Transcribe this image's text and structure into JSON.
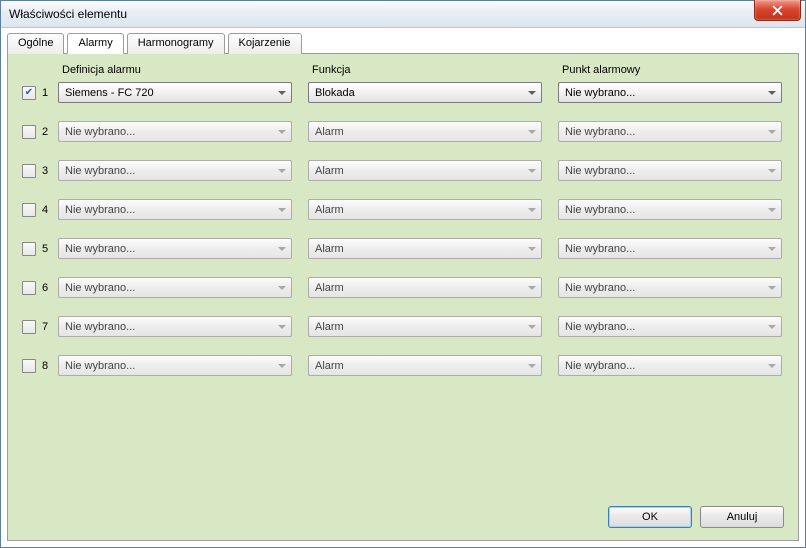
{
  "window": {
    "title": "Właściwości elementu"
  },
  "tabs": {
    "general": "Ogólne",
    "alarms": "Alarmy",
    "schedules": "Harmonogramy",
    "pairing": "Kojarzenie"
  },
  "headers": {
    "definition": "Definicja alarmu",
    "function": "Funkcja",
    "point": "Punkt alarmowy"
  },
  "rows": [
    {
      "n": "1",
      "checked": true,
      "enabled": true,
      "definition": "Siemens - FC 720",
      "function": "Blokada",
      "point": "Nie wybrano..."
    },
    {
      "n": "2",
      "checked": false,
      "enabled": false,
      "definition": "Nie wybrano...",
      "function": "Alarm",
      "point": "Nie wybrano..."
    },
    {
      "n": "3",
      "checked": false,
      "enabled": false,
      "definition": "Nie wybrano...",
      "function": "Alarm",
      "point": "Nie wybrano..."
    },
    {
      "n": "4",
      "checked": false,
      "enabled": false,
      "definition": "Nie wybrano...",
      "function": "Alarm",
      "point": "Nie wybrano..."
    },
    {
      "n": "5",
      "checked": false,
      "enabled": false,
      "definition": "Nie wybrano...",
      "function": "Alarm",
      "point": "Nie wybrano..."
    },
    {
      "n": "6",
      "checked": false,
      "enabled": false,
      "definition": "Nie wybrano...",
      "function": "Alarm",
      "point": "Nie wybrano..."
    },
    {
      "n": "7",
      "checked": false,
      "enabled": false,
      "definition": "Nie wybrano...",
      "function": "Alarm",
      "point": "Nie wybrano..."
    },
    {
      "n": "8",
      "checked": false,
      "enabled": false,
      "definition": "Nie wybrano...",
      "function": "Alarm",
      "point": "Nie wybrano..."
    }
  ],
  "buttons": {
    "ok": "OK",
    "cancel": "Anuluj"
  }
}
